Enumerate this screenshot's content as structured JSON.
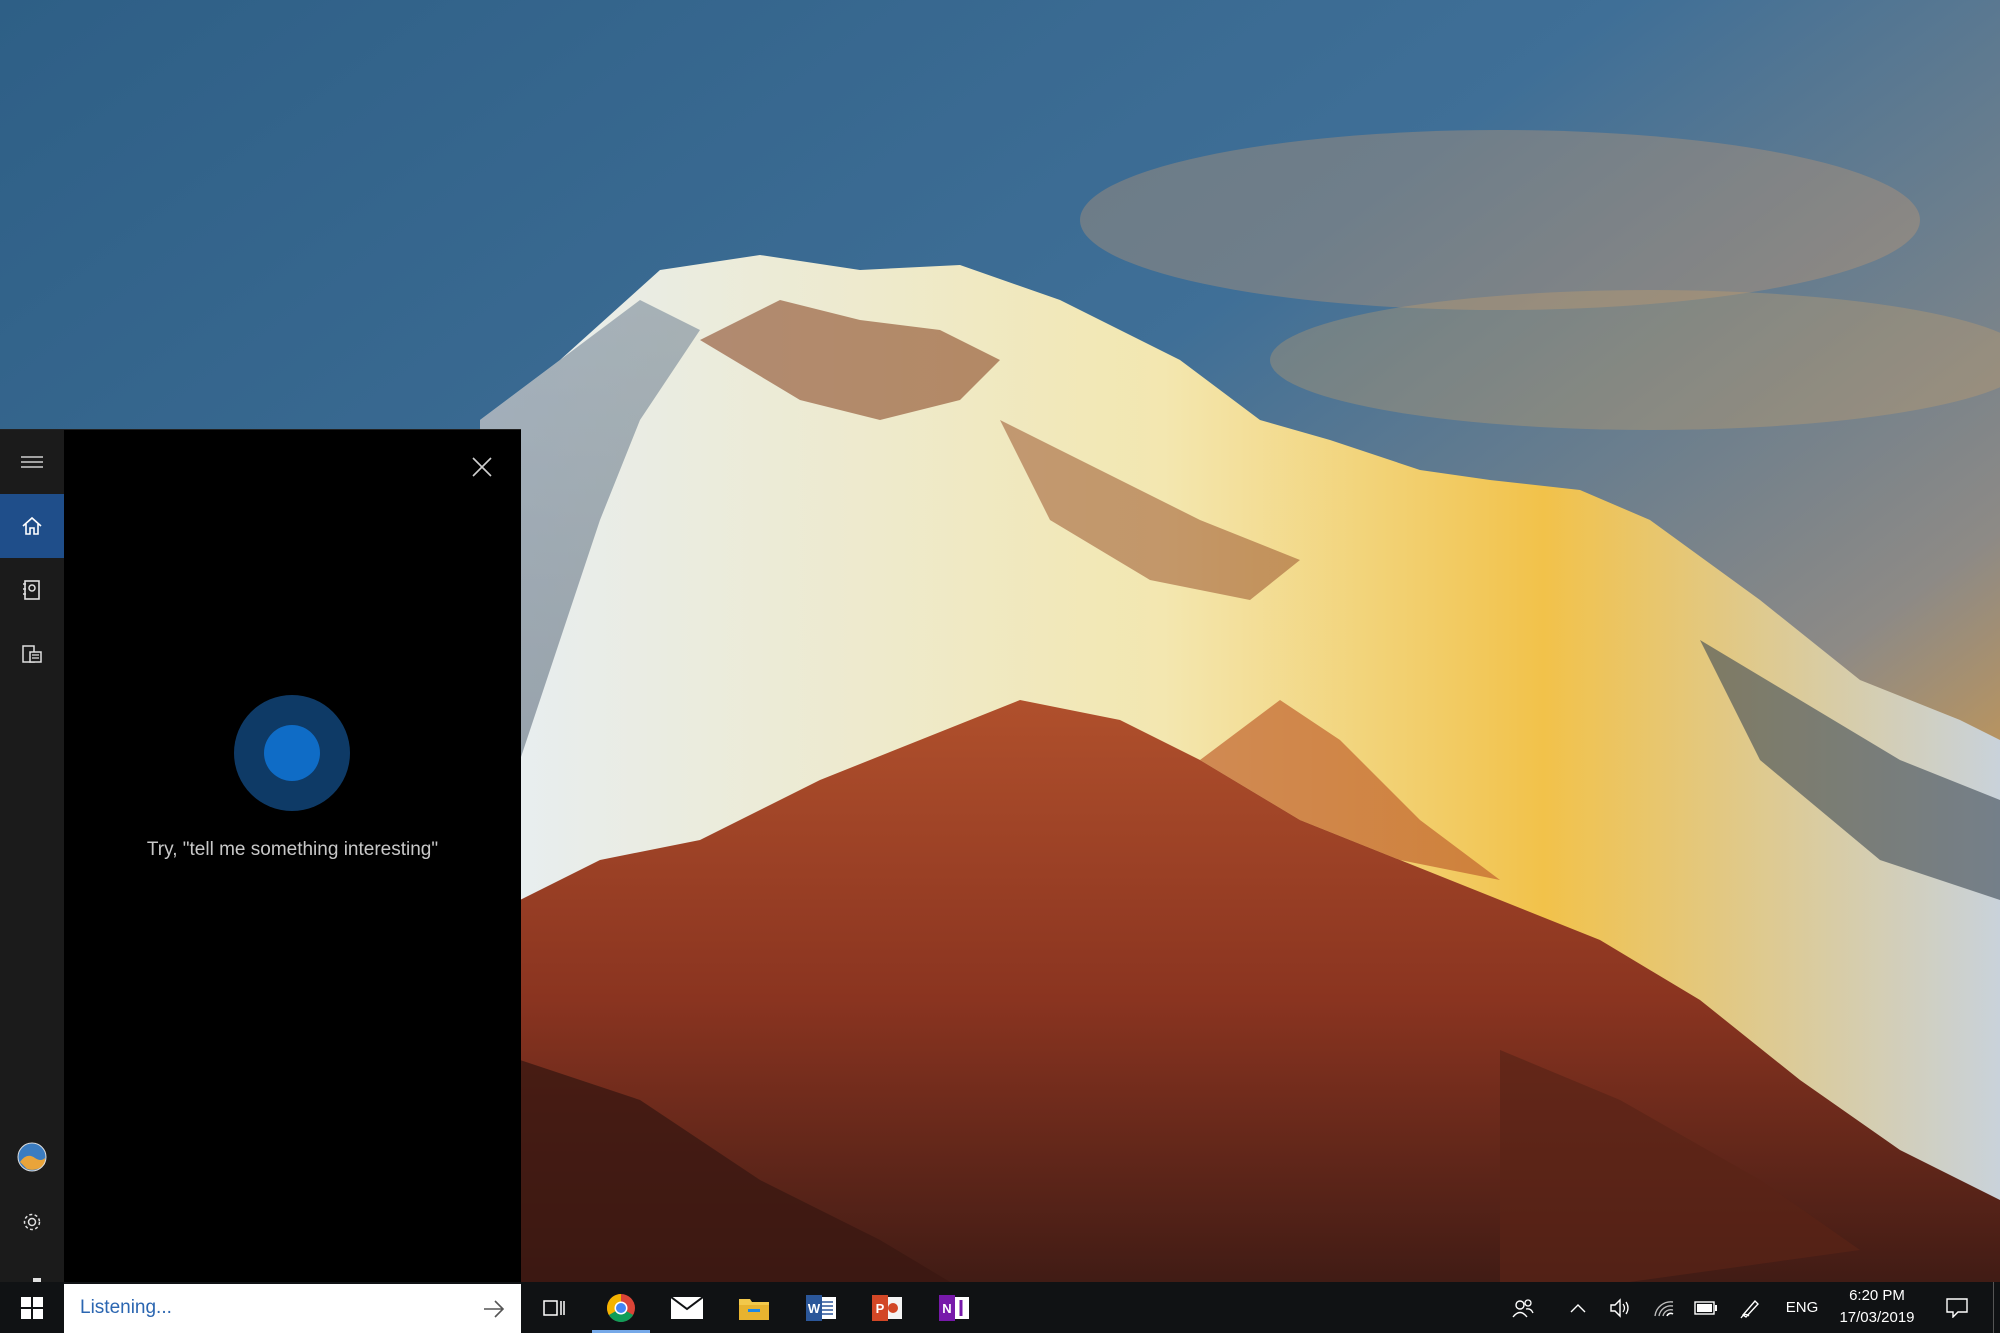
{
  "cortana": {
    "hint": "Try, \"tell me something interesting\"",
    "rail_items": [
      "hamburger-icon",
      "home-icon",
      "notebook-icon",
      "devices-icon",
      "avatar",
      "gear-icon",
      "feedback-icon"
    ],
    "accent": "#1f4e8a",
    "orb_outer": "#0e3a66",
    "orb_inner": "#0f6cc6"
  },
  "search": {
    "value": "Listening..."
  },
  "taskbar": {
    "apps": [
      "task-view-icon",
      "chrome-icon",
      "mail-icon",
      "file-explorer-icon",
      "word-icon",
      "powerpoint-icon",
      "onenote-icon"
    ],
    "tray": [
      "people-icon",
      "chevron-up-icon",
      "volume-icon",
      "wifi-icon",
      "battery-icon",
      "pen-icon"
    ],
    "language": "ENG",
    "time": "6:20 PM",
    "date": "17/03/2019"
  }
}
